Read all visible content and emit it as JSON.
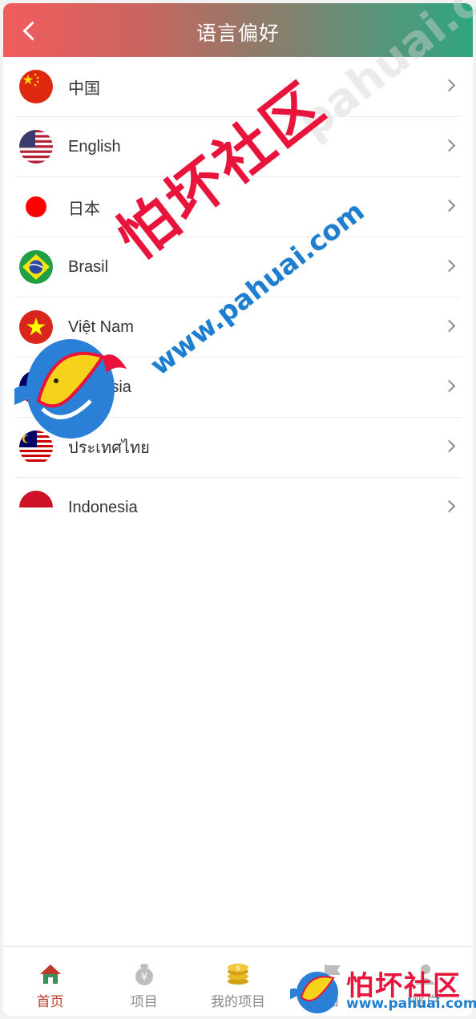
{
  "header": {
    "title": "语言偏好",
    "back_icon": "chevron-left-icon"
  },
  "languages": [
    {
      "label": "中国",
      "flag": "china-flag-icon"
    },
    {
      "label": "English",
      "flag": "usa-flag-icon"
    },
    {
      "label": "日本",
      "flag": "japan-flag-icon"
    },
    {
      "label": "Brasil",
      "flag": "brazil-flag-icon"
    },
    {
      "label": "Việt Nam",
      "flag": "vietnam-flag-icon"
    },
    {
      "label": "Malaysia",
      "flag": "malaysia-flag-icon"
    },
    {
      "label": "ประเทศไทย",
      "flag": "malaysia-flag-icon"
    },
    {
      "label": "Indonesia",
      "flag": "indonesia-flag-icon"
    }
  ],
  "tabbar": {
    "items": [
      {
        "label": "首页",
        "icon": "home-icon",
        "active": true
      },
      {
        "label": "项目",
        "icon": "money-bag-icon",
        "active": false
      },
      {
        "label": "我的项目",
        "icon": "coins-icon",
        "active": false
      },
      {
        "label": "知",
        "icon": "flag-icon",
        "active": false
      },
      {
        "label": "账户",
        "icon": "user-icon",
        "active": false
      }
    ]
  },
  "watermark": {
    "brand": "怕坏社区",
    "url": "www.pahuai.com",
    "faint_url": "pahuai.com"
  },
  "colors": {
    "header_gradient_start": "#f25b5e",
    "header_gradient_end": "#2fa57f",
    "active_tab": "#c0392b",
    "inactive_tab": "#8a8a8a"
  }
}
